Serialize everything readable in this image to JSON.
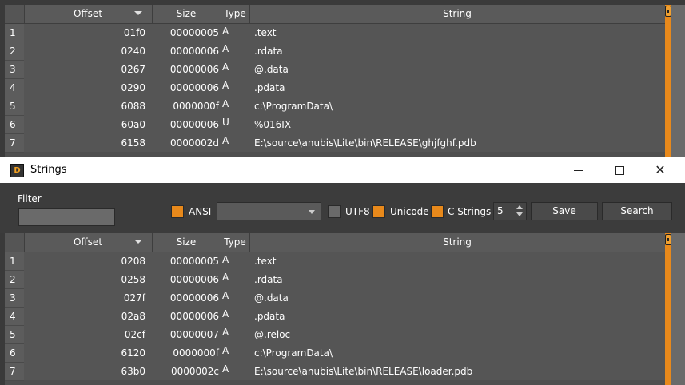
{
  "columns": {
    "offset": "Offset",
    "size": "Size",
    "type": "Type",
    "string": "String"
  },
  "top_table": {
    "rows": [
      {
        "n": "1",
        "offset": "01f0",
        "size": "00000005",
        "type": "A",
        "string": ".text"
      },
      {
        "n": "2",
        "offset": "0240",
        "size": "00000006",
        "type": "A",
        "string": ".rdata"
      },
      {
        "n": "3",
        "offset": "0267",
        "size": "00000006",
        "type": "A",
        "string": "@.data"
      },
      {
        "n": "4",
        "offset": "0290",
        "size": "00000006",
        "type": "A",
        "string": ".pdata"
      },
      {
        "n": "5",
        "offset": "6088",
        "size": "0000000f",
        "type": "A",
        "string": "c:\\ProgramData\\"
      },
      {
        "n": "6",
        "offset": "60a0",
        "size": "00000006",
        "type": "U",
        "string": "%016IX"
      },
      {
        "n": "7",
        "offset": "6158",
        "size": "0000002d",
        "type": "A",
        "string": "E:\\source\\anubis\\Lite\\bin\\RELEASE\\ghjfghf.pdb"
      }
    ]
  },
  "window": {
    "title": "Strings",
    "icon_text": "D"
  },
  "toolbar": {
    "filter_label": "Filter",
    "filter_value": "",
    "ansi_label": "ANSI",
    "ansi_checked": true,
    "encoding_value": "",
    "utf8_label": "UTF8",
    "utf8_checked": false,
    "unicode_label": "Unicode",
    "unicode_checked": true,
    "cstrings_label": "C Strings",
    "cstrings_checked": true,
    "min_length": "5",
    "save_label": "Save",
    "search_label": "Search"
  },
  "bottom_table": {
    "rows": [
      {
        "n": "1",
        "offset": "0208",
        "size": "00000005",
        "type": "A",
        "string": ".text"
      },
      {
        "n": "2",
        "offset": "0258",
        "size": "00000006",
        "type": "A",
        "string": ".rdata"
      },
      {
        "n": "3",
        "offset": "027f",
        "size": "00000006",
        "type": "A",
        "string": "@.data"
      },
      {
        "n": "4",
        "offset": "02a8",
        "size": "00000006",
        "type": "A",
        "string": ".pdata"
      },
      {
        "n": "5",
        "offset": "02cf",
        "size": "00000007",
        "type": "A",
        "string": "@.reloc"
      },
      {
        "n": "6",
        "offset": "6120",
        "size": "0000000f",
        "type": "A",
        "string": "c:\\ProgramData\\"
      },
      {
        "n": "7",
        "offset": "63b0",
        "size": "0000002c",
        "type": "A",
        "string": "E:\\source\\anubis\\Lite\\bin\\RELEASE\\loader.pdb"
      }
    ]
  },
  "colors": {
    "accent": "#e8891b",
    "panel": "#555555",
    "toolbar": "#3c3c3c"
  }
}
